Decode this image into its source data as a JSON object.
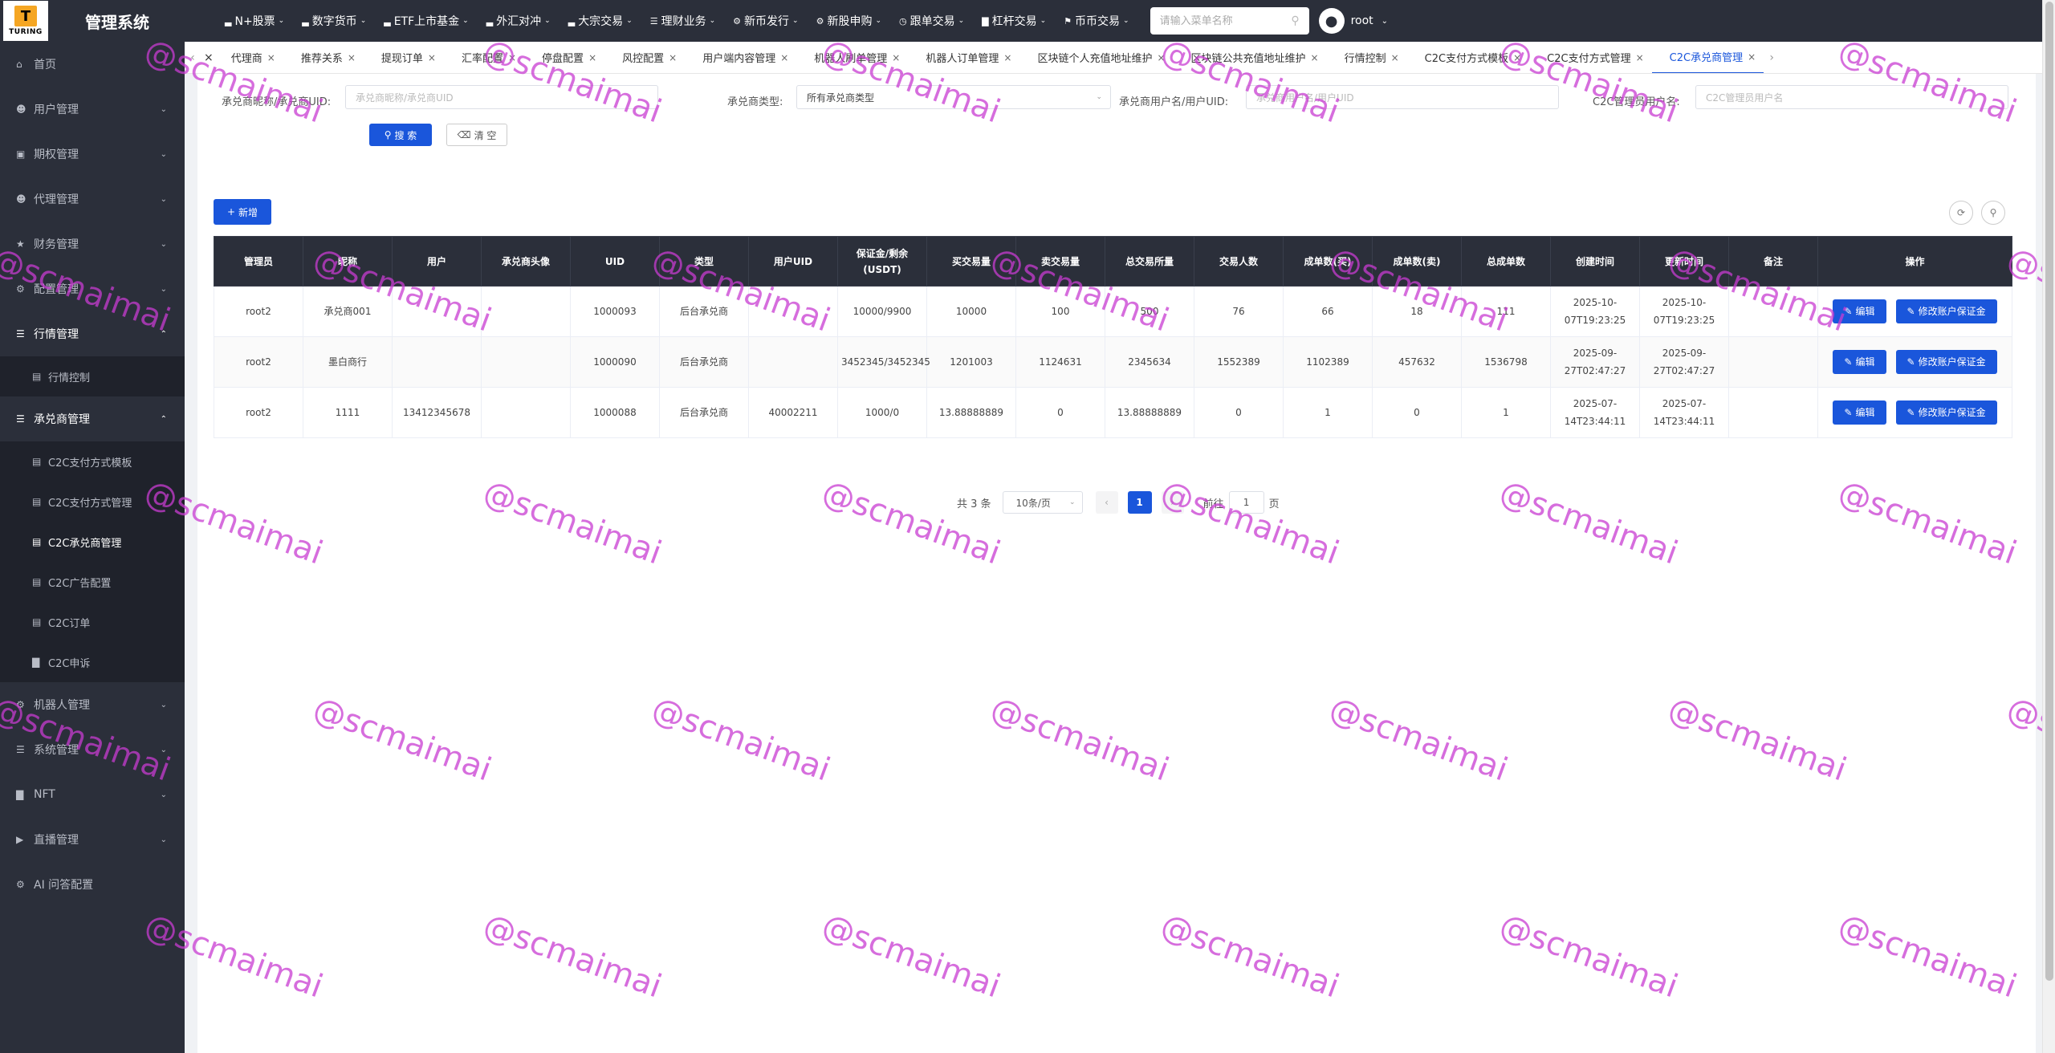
{
  "header": {
    "logo_text": "TURING",
    "logo_mark": "T",
    "title": "管理系统",
    "nav": [
      {
        "label": "N+股票",
        "icon": "chart-icon"
      },
      {
        "label": "数字货币",
        "icon": "chart-icon"
      },
      {
        "label": "ETF上市基金",
        "icon": "chart-icon"
      },
      {
        "label": "外汇对冲",
        "icon": "chart-icon"
      },
      {
        "label": "大宗交易",
        "icon": "chart-icon"
      },
      {
        "label": "理财业务",
        "icon": "list-icon"
      },
      {
        "label": "新币发行",
        "icon": "gear-icon"
      },
      {
        "label": "新股申购",
        "icon": "gear-icon"
      },
      {
        "label": "跟单交易",
        "icon": "clock-icon"
      },
      {
        "label": "杠杆交易",
        "icon": "bars-icon"
      },
      {
        "label": "币币交易",
        "icon": "pin-icon"
      }
    ],
    "search_placeholder": "请输入菜单名称",
    "username": "root"
  },
  "sidebar": {
    "items": [
      {
        "label": "首页",
        "icon": "home-icon"
      },
      {
        "label": "用户管理",
        "icon": "user-icon"
      },
      {
        "label": "期权管理",
        "icon": "monitor-icon"
      },
      {
        "label": "代理管理",
        "icon": "user-icon"
      },
      {
        "label": "财务管理",
        "icon": "star-icon"
      },
      {
        "label": "配置管理",
        "icon": "gear-icon"
      },
      {
        "label": "行情管理",
        "icon": "list-icon"
      }
    ],
    "market_sub": [
      {
        "label": "行情控制",
        "icon": "doc-icon"
      }
    ],
    "acceptor_group": {
      "label": "承兑商管理",
      "icon": "list-icon"
    },
    "acceptor_sub": [
      {
        "label": "C2C支付方式模板",
        "icon": "doc-icon"
      },
      {
        "label": "C2C支付方式管理",
        "icon": "doc-icon"
      },
      {
        "label": "C2C承兑商管理",
        "icon": "doc-icon"
      },
      {
        "label": "C2C广告配置",
        "icon": "doc-icon"
      },
      {
        "label": "C2C订单",
        "icon": "doc-icon"
      },
      {
        "label": "C2C申诉",
        "icon": "bars-icon"
      }
    ],
    "bottom_items": [
      {
        "label": "机器人管理",
        "icon": "gear-icon"
      },
      {
        "label": "系统管理",
        "icon": "list-icon"
      },
      {
        "label": "NFT",
        "icon": "bars-icon"
      },
      {
        "label": "直播管理",
        "icon": "video-icon"
      },
      {
        "label": "AI 问答配置",
        "icon": "gear-icon"
      }
    ]
  },
  "tabs": [
    {
      "label": "代理商"
    },
    {
      "label": "推荐关系"
    },
    {
      "label": "提现订单"
    },
    {
      "label": "汇率配置"
    },
    {
      "label": "停盘配置"
    },
    {
      "label": "风控配置"
    },
    {
      "label": "用户端内容管理"
    },
    {
      "label": "机器人刷单管理"
    },
    {
      "label": "机器人订单管理"
    },
    {
      "label": "区块链个人充值地址维护"
    },
    {
      "label": "区块链公共充值地址维护"
    },
    {
      "label": "行情控制"
    },
    {
      "label": "C2C支付方式模板"
    },
    {
      "label": "C2C支付方式管理"
    },
    {
      "label": "C2C承兑商管理"
    }
  ],
  "filters": {
    "nick_label": "承兑商昵称/承兑商UID:",
    "nick_placeholder": "承兑商昵称/承兑商UID",
    "type_label": "承兑商类型:",
    "type_value": "所有承兑商类型",
    "user_label": "承兑商用户名/用户UID:",
    "user_placeholder": "承兑商用户名/用户UID",
    "admin_label": "C2C管理员用户名:",
    "admin_placeholder": "C2C管理员用户名",
    "search_btn": "搜 索",
    "clear_btn": "清 空",
    "add_btn": "新增"
  },
  "table": {
    "columns": [
      "管理员",
      "昵称",
      "用户",
      "承兑商头像",
      "UID",
      "类型",
      "用户UID",
      "保证金/剩余(USDT)",
      "买交易量",
      "卖交易量",
      "总交易所量",
      "交易人数",
      "成单数(买)",
      "成单数(卖)",
      "总成单数",
      "创建时间",
      "更新时间",
      "备注",
      "操作"
    ],
    "rows": [
      [
        "root2",
        "承兑商001",
        "",
        "",
        "1000093",
        "后台承兑商",
        "",
        "10000/9900",
        "10000",
        "100",
        "500",
        "76",
        "66",
        "18",
        "111",
        "2025-10-07T19:23:25",
        "2025-10-07T19:23:25",
        ""
      ],
      [
        "root2",
        "墨白商行",
        "",
        "",
        "1000090",
        "后台承兑商",
        "",
        "3452345/3452345",
        "1201003",
        "1124631",
        "2345634",
        "1552389",
        "1102389",
        "457632",
        "1536798",
        "2025-09-27T02:47:27",
        "2025-09-27T02:47:27",
        ""
      ],
      [
        "root2",
        "1111",
        "13412345678",
        "",
        "1000088",
        "后台承兑商",
        "40002211",
        "1000/0",
        "13.88888889",
        "0",
        "13.88888889",
        "0",
        "1",
        "0",
        "1",
        "2025-07-14T23:44:11",
        "2025-07-14T23:44:11",
        ""
      ]
    ],
    "edit_label": "编辑",
    "deposit_label": "修改账户保证金"
  },
  "pagination": {
    "total": "共 3 条",
    "page_size": "10条/页",
    "current": "1",
    "goto": "前往",
    "goto_value": "1",
    "unit": "页"
  },
  "watermark": "@scmaimai",
  "colors": {
    "primary": "#1a56db",
    "dark": "#2b2f3a",
    "watermark": "#c83cd2"
  }
}
